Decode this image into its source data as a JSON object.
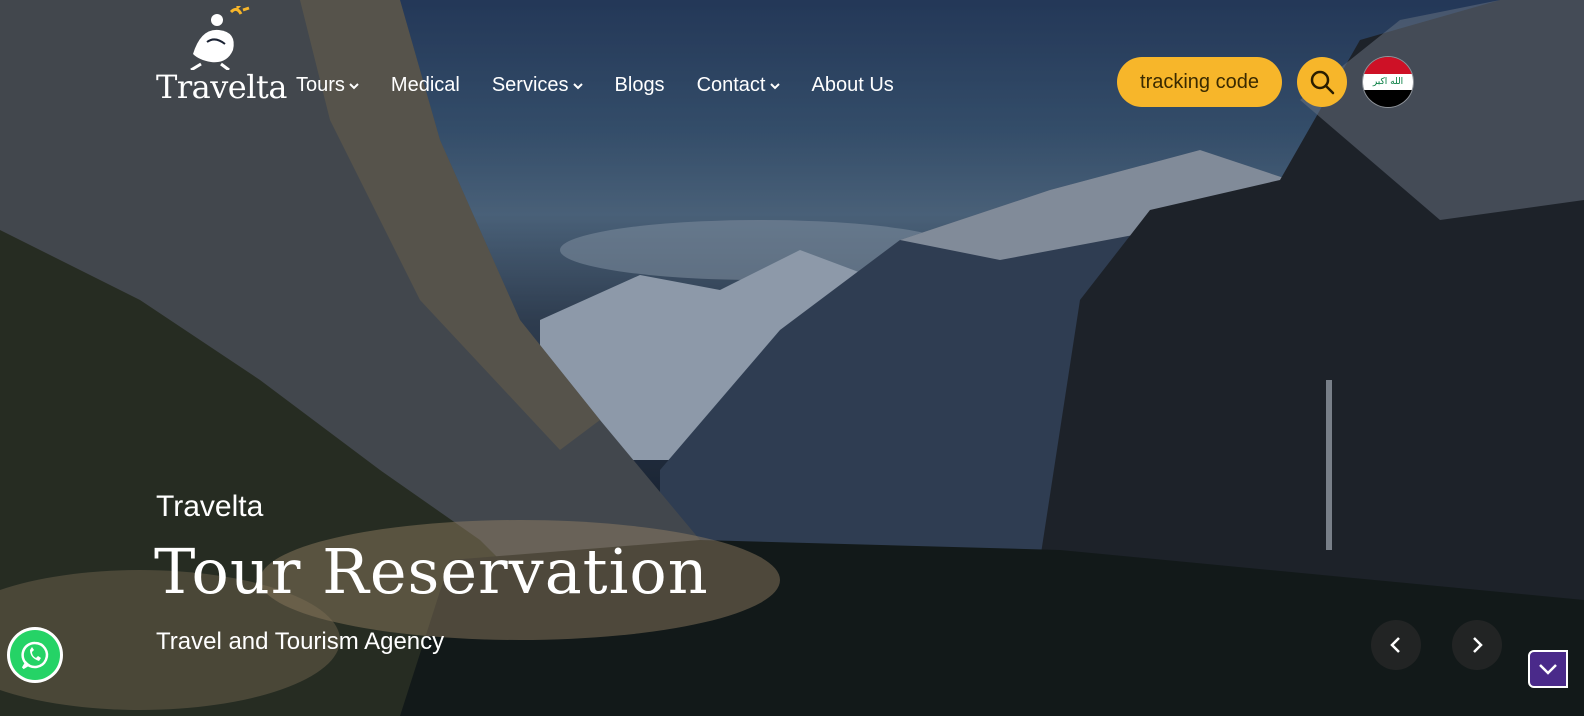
{
  "brand": {
    "name": "Travelta",
    "logo_icon": "traveler-figure-icon"
  },
  "nav": {
    "items": [
      {
        "label": "Tours",
        "has_dropdown": true
      },
      {
        "label": "Medical",
        "has_dropdown": false
      },
      {
        "label": "Services",
        "has_dropdown": true
      },
      {
        "label": "Blogs",
        "has_dropdown": false
      },
      {
        "label": "Contact",
        "has_dropdown": true
      },
      {
        "label": "About Us",
        "has_dropdown": false
      }
    ]
  },
  "header": {
    "tracking_label": "tracking code",
    "search_icon": "search-icon",
    "language_flag": "iraq-flag",
    "flag_script": "الله اكبر"
  },
  "hero": {
    "kicker": "Travelta",
    "title": "Tour Reservation",
    "subtitle": "Travel and Tourism Agency"
  },
  "colors": {
    "accent": "#f7b62a",
    "whatsapp": "#25d366",
    "scroll_button": "#4a2a8a"
  }
}
